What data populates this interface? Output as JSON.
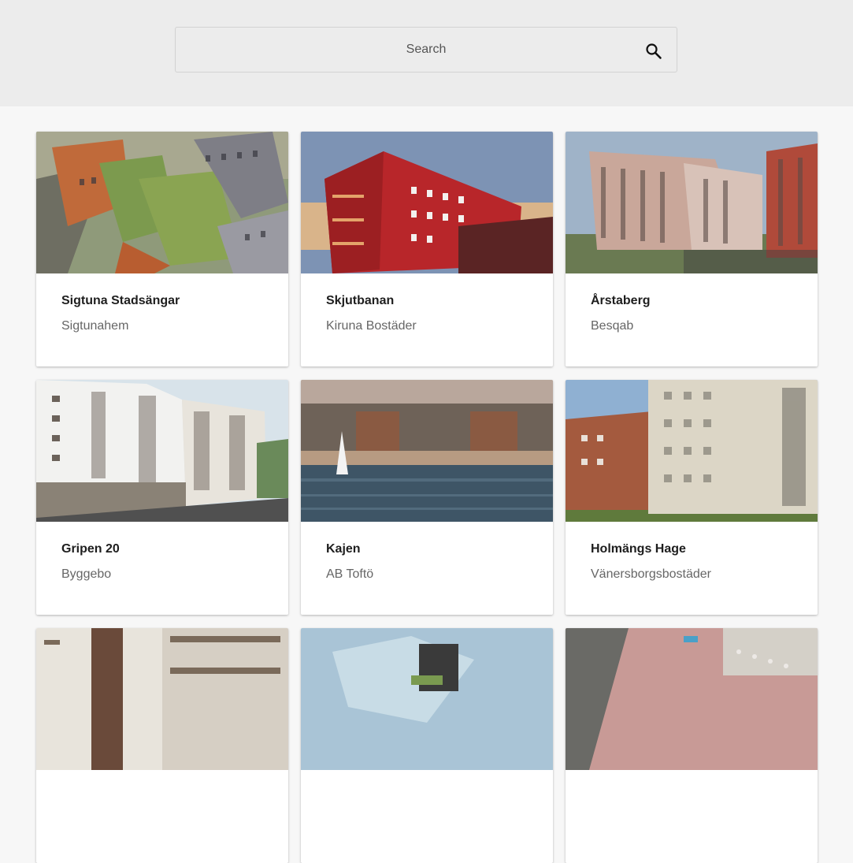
{
  "search": {
    "placeholder": "Search",
    "icon": "search-icon"
  },
  "projects": [
    {
      "title": "Sigtuna Stadsängar",
      "company": "Sigtunahem"
    },
    {
      "title": "Skjutbanan",
      "company": "Kiruna Bostäder"
    },
    {
      "title": "Årstaberg",
      "company": "Besqab"
    },
    {
      "title": "Gripen 20",
      "company": "Byggebo"
    },
    {
      "title": "Kajen",
      "company": "AB Toftö"
    },
    {
      "title": "Holmängs Hage",
      "company": "Vänersborgsbostäder"
    }
  ],
  "colors": {
    "header_bg": "#ececec",
    "page_bg": "#f7f7f7",
    "card_bg": "#ffffff"
  }
}
